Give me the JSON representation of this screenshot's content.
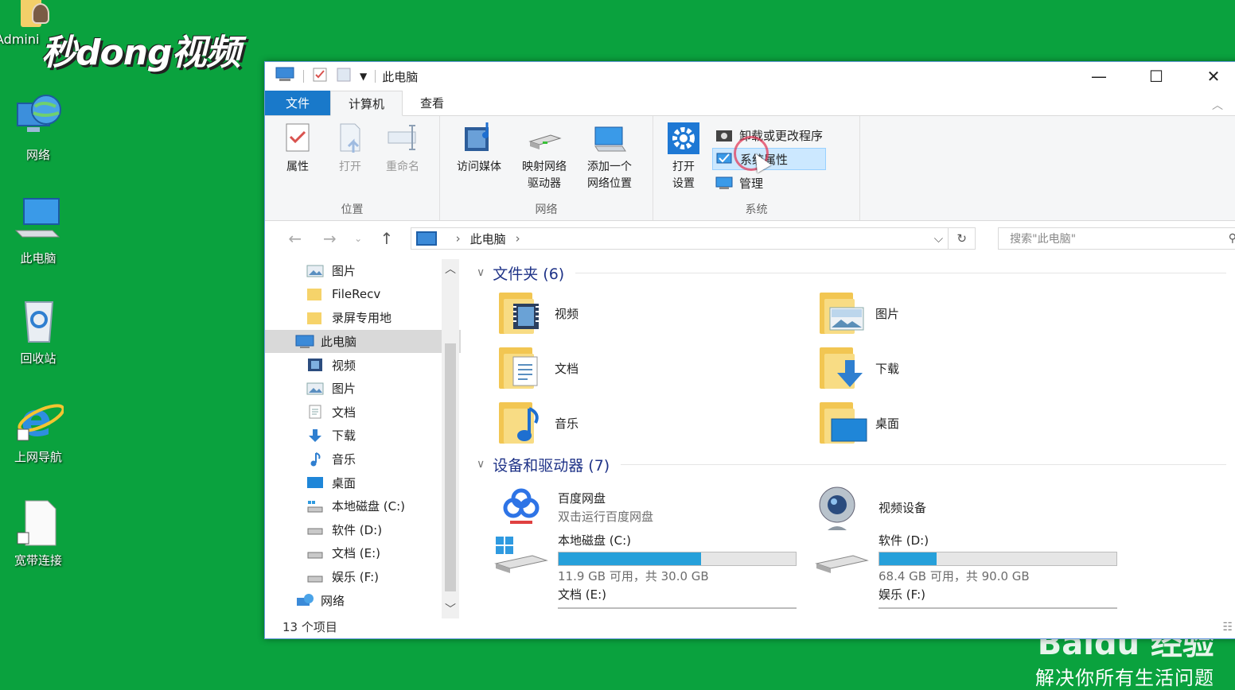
{
  "desktop": {
    "user_label": "Admini",
    "watermark_logo": "秒dong视频",
    "icons": [
      {
        "label": "网络",
        "icon": "network-globe-icon"
      },
      {
        "label": "此电脑",
        "icon": "computer-icon"
      },
      {
        "label": "回收站",
        "icon": "recycle-bin-icon"
      },
      {
        "label": "上网导航",
        "icon": "ie-browser-icon"
      },
      {
        "label": "宽带连接",
        "icon": "document-shortcut-icon"
      }
    ],
    "baidu_logo": "Baidu 经验",
    "baidu_slogan": "解决你所有生活问题"
  },
  "window": {
    "title": "此电脑",
    "controls": {
      "minimize": "—",
      "maximize": "☐",
      "close": "✕"
    },
    "tabs": [
      "文件",
      "计算机",
      "查看"
    ],
    "ribbon": {
      "groups": [
        {
          "name": "位置",
          "buttons": [
            "属性",
            "打开",
            "重命名"
          ]
        },
        {
          "name": "网络",
          "buttons": [
            "访问媒体",
            "映射网络\n驱动器",
            "添加一个\n网络位置"
          ]
        },
        {
          "name": "系统",
          "big_button": "打开\n设置",
          "small_buttons": [
            "卸载或更改程序",
            "系统属性",
            "管理"
          ]
        }
      ]
    },
    "address": {
      "path": "此电脑",
      "search_placeholder": "搜索\"此电脑\""
    },
    "nav_tree": [
      {
        "label": "图片",
        "pinned": true
      },
      {
        "label": "FileRecv"
      },
      {
        "label": "录屏专用地"
      },
      {
        "label": "此电脑",
        "selected": true
      },
      {
        "label": "视频"
      },
      {
        "label": "图片"
      },
      {
        "label": "文档"
      },
      {
        "label": "下载"
      },
      {
        "label": "音乐"
      },
      {
        "label": "桌面"
      },
      {
        "label": "本地磁盘 (C:)"
      },
      {
        "label": "软件 (D:)"
      },
      {
        "label": "文档 (E:)"
      },
      {
        "label": "娱乐 (F:)"
      },
      {
        "label": "网络"
      }
    ],
    "sections": {
      "folders_header": "文件夹 (6)",
      "folders": [
        "视频",
        "图片",
        "文档",
        "下载",
        "音乐",
        "桌面"
      ],
      "drives_header": "设备和驱动器 (7)",
      "devices": [
        {
          "name": "百度网盘",
          "sub": "双击运行百度网盘"
        },
        {
          "name": "视频设备"
        }
      ],
      "drives": [
        {
          "name": "本地磁盘 (C:)",
          "free": "11.9 GB 可用，共 30.0 GB",
          "used_fraction": 0.6
        },
        {
          "name": "软件 (D:)",
          "free": "68.4 GB 可用，共 90.0 GB",
          "used_fraction": 0.24
        },
        {
          "name": "文档 (E:)"
        },
        {
          "name": "娱乐 (F:)"
        }
      ]
    },
    "status": "13 个项目"
  }
}
